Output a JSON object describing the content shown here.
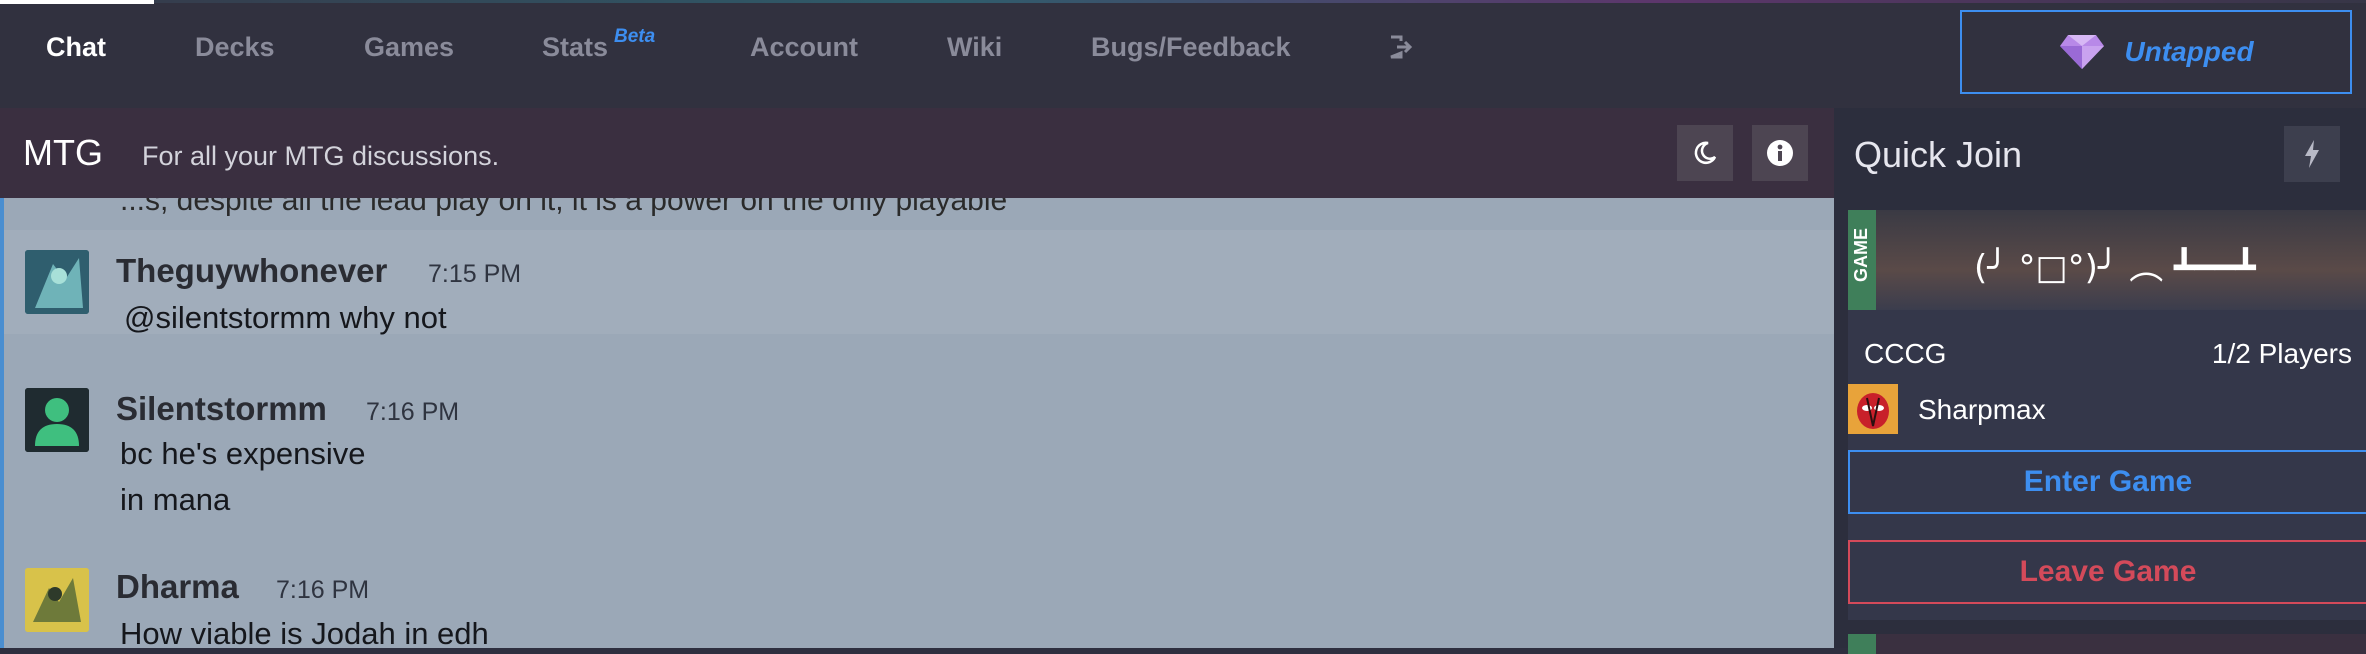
{
  "nav": {
    "items": [
      {
        "label": "Chat",
        "active": true
      },
      {
        "label": "Decks"
      },
      {
        "label": "Games"
      },
      {
        "label": "Stats",
        "badge": "Beta"
      },
      {
        "label": "Account"
      },
      {
        "label": "Wiki"
      },
      {
        "label": "Bugs/Feedback"
      }
    ],
    "logout_icon": "logout-icon",
    "untapped_label": "Untapped",
    "untapped_icon": "diamond-icon"
  },
  "channel": {
    "name": "MTG",
    "description": "For all your MTG discussions.",
    "theme_icon": "moon-icon",
    "info_icon": "info-icon"
  },
  "chat": {
    "partial_line": "...s, despite all the lead play on it, it is a power on the only playable",
    "messages": [
      {
        "author": "Theguywhonever",
        "time": "7:15 PM",
        "lines": [
          "@silentstormm why not"
        ]
      },
      {
        "author": "Silentstormm",
        "time": "7:16 PM",
        "lines": [
          "bc he's expensive",
          "in mana"
        ]
      },
      {
        "author": "Dharma",
        "time": "7:16 PM",
        "lines": [
          "How viable is Jodah in edh"
        ]
      }
    ]
  },
  "quick_join": {
    "title": "Quick Join",
    "bolt_icon": "lightning-icon",
    "card": {
      "tag": "GAME",
      "banner_text": "(╯ °□°)╯ ︵ ┻━━┻",
      "game_name": "CCCG",
      "players": "1/2 Players",
      "player_name": "Sharpmax",
      "enter_label": "Enter Game",
      "leave_label": "Leave Game"
    }
  },
  "colors": {
    "accent_blue": "#3d8ef0",
    "leave_red": "#d44a5a",
    "chat_bg": "#9ba8b7",
    "game_tag_green": "#3f7f5a"
  }
}
